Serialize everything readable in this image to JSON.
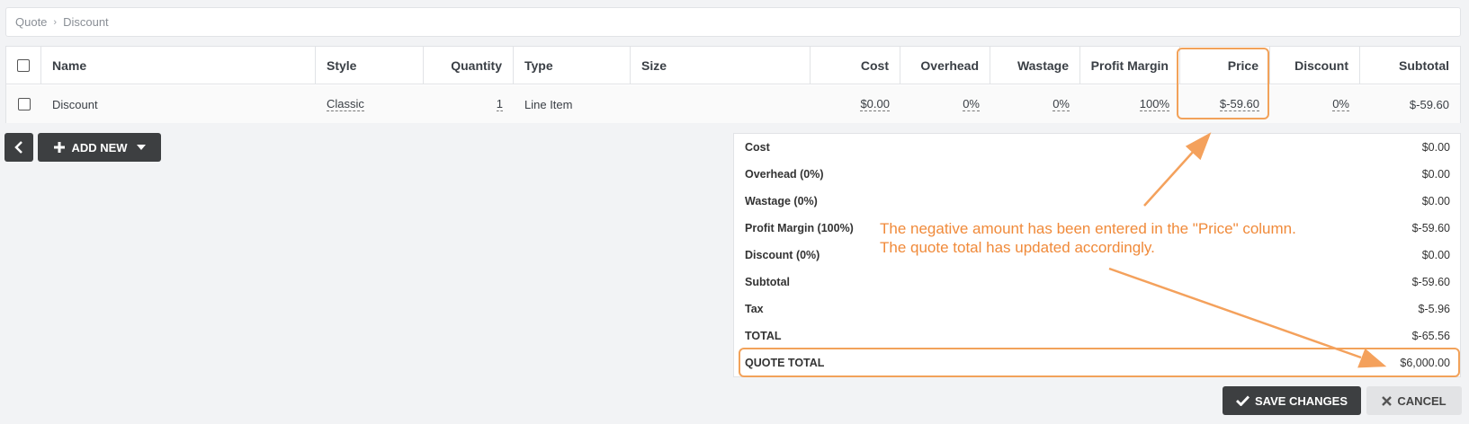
{
  "breadcrumb": {
    "root": "Quote",
    "current": "Discount"
  },
  "table": {
    "headers": {
      "name": "Name",
      "style": "Style",
      "quantity": "Quantity",
      "type": "Type",
      "size": "Size",
      "cost": "Cost",
      "overhead": "Overhead",
      "wastage": "Wastage",
      "profit_margin": "Profit Margin",
      "price": "Price",
      "discount": "Discount",
      "subtotal": "Subtotal"
    },
    "row": {
      "name": "Discount",
      "style": "Classic",
      "quantity": "1",
      "type": "Line Item",
      "size": "",
      "cost": "$0.00",
      "overhead": "0%",
      "wastage": "0%",
      "profit_margin": "100%",
      "price": "$-59.60",
      "discount": "0%",
      "subtotal": "$-59.60"
    }
  },
  "toolbar": {
    "add_new_label": "ADD NEW"
  },
  "summary": [
    {
      "label": "Cost",
      "value": "$0.00"
    },
    {
      "label": "Overhead (0%)",
      "value": "$0.00"
    },
    {
      "label": "Wastage (0%)",
      "value": "$0.00"
    },
    {
      "label": "Profit Margin (100%)",
      "value": "$-59.60"
    },
    {
      "label": "Discount (0%)",
      "value": "$0.00"
    },
    {
      "label": "Subtotal",
      "value": "$-59.60"
    },
    {
      "label": "Tax",
      "value": "$-5.96"
    },
    {
      "label": "TOTAL",
      "value": "$-65.56"
    },
    {
      "label": "QUOTE TOTAL",
      "value": "$6,000.00"
    }
  ],
  "actions": {
    "save_label": "SAVE CHANGES",
    "cancel_label": "CANCEL"
  },
  "annotation": {
    "line1": "The negative amount has been entered in the \"Price\" column.",
    "line2": "The quote total has updated accordingly.",
    "color": "#f08a3a"
  }
}
